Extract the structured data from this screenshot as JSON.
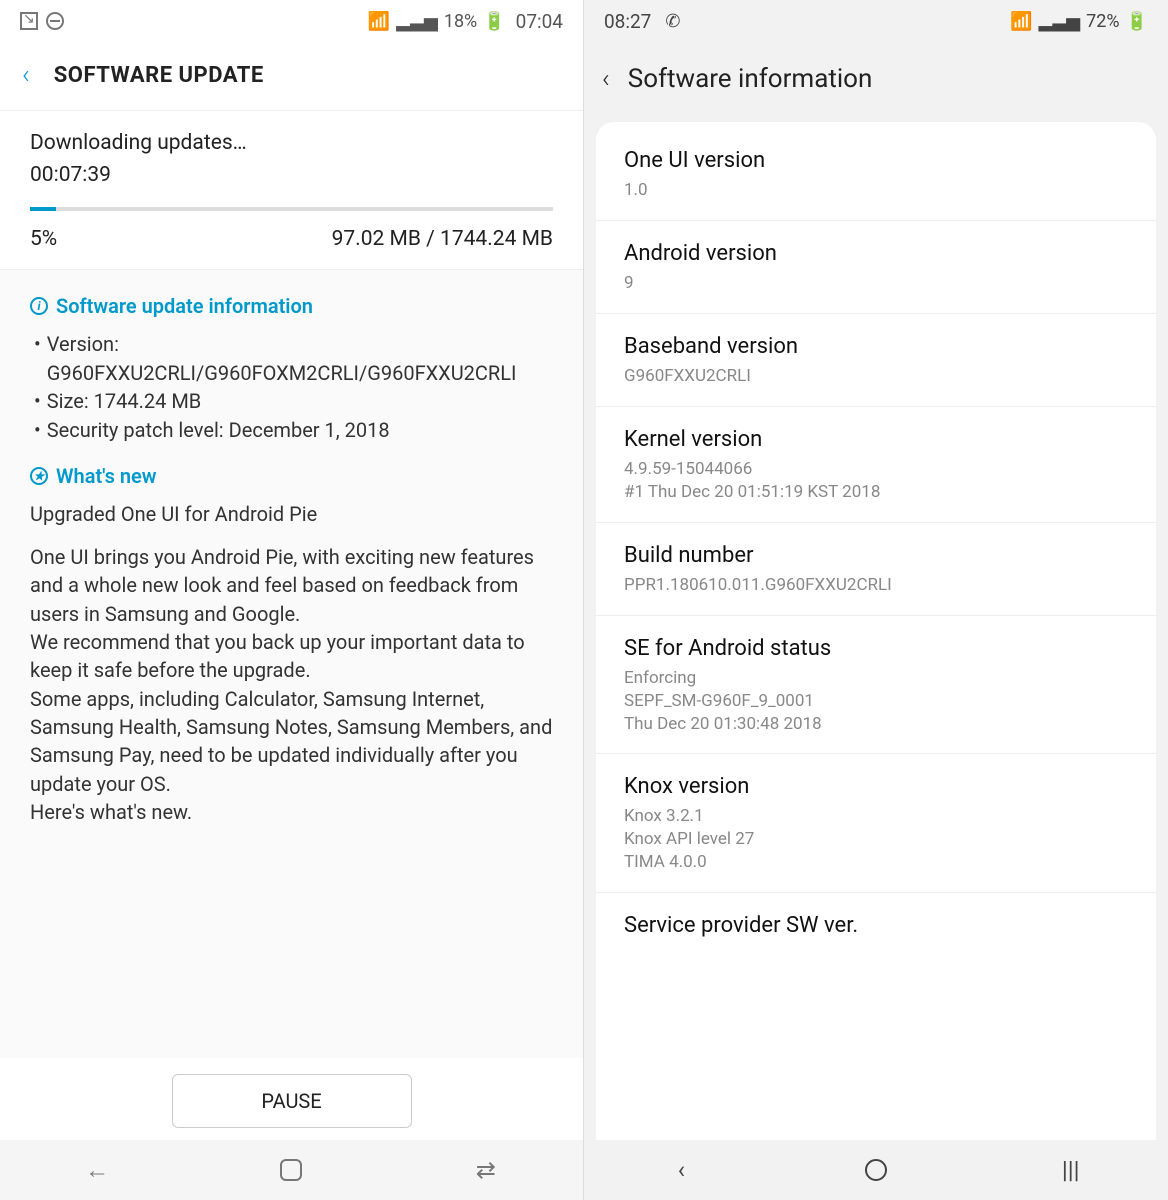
{
  "left": {
    "status": {
      "battery_pct": "18%",
      "time": "07:04"
    },
    "header": {
      "title": "SOFTWARE UPDATE"
    },
    "download": {
      "label": "Downloading updates…",
      "elapsed": "00:07:39",
      "percent": "5%",
      "percent_num": 5,
      "progress": "97.02 MB / 1744.24 MB"
    },
    "update_info": {
      "title": "Software update information",
      "version_label": "Version:",
      "version": "G960FXXU2CRLI/G960FOXM2CRLI/G960FXXU2CRLI",
      "size_label": "Size:",
      "size": "1744.24 MB",
      "patch_label": "Security patch level:",
      "patch": "December 1, 2018"
    },
    "whats_new": {
      "title": "What's new",
      "headline": "Upgraded One UI for Android Pie",
      "p1": "One UI brings you Android Pie, with exciting new features and a whole new look and feel based on feedback from users in Samsung and Google.",
      "p2": "We recommend that you back up your important data to keep it safe before the upgrade.",
      "p3": "Some apps, including Calculator, Samsung Internet, Samsung Health, Samsung Notes, Samsung Members, and Samsung Pay, need to be updated individually after you update your OS.",
      "p4": "Here's what's new."
    },
    "pause": "PAUSE"
  },
  "right": {
    "status": {
      "time": "08:27",
      "battery_pct": "72%"
    },
    "header": {
      "title": "Software information"
    },
    "rows": {
      "one_ui": {
        "label": "One UI version",
        "value": "1.0"
      },
      "android": {
        "label": "Android version",
        "value": "9"
      },
      "baseband": {
        "label": "Baseband version",
        "value": "G960FXXU2CRLI"
      },
      "kernel": {
        "label": "Kernel version",
        "value1": "4.9.59-15044066",
        "value2": "#1 Thu Dec 20 01:51:19 KST 2018"
      },
      "build": {
        "label": "Build number",
        "value": "PPR1.180610.011.G960FXXU2CRLI"
      },
      "se": {
        "label": "SE for Android status",
        "value1": "Enforcing",
        "value2": "SEPF_SM-G960F_9_0001",
        "value3": "Thu Dec 20 01:30:48 2018"
      },
      "knox": {
        "label": "Knox version",
        "value1": "Knox 3.2.1",
        "value2": "Knox API level 27",
        "value3": "TIMA 4.0.0"
      },
      "provider": {
        "label": "Service provider SW ver."
      }
    }
  }
}
